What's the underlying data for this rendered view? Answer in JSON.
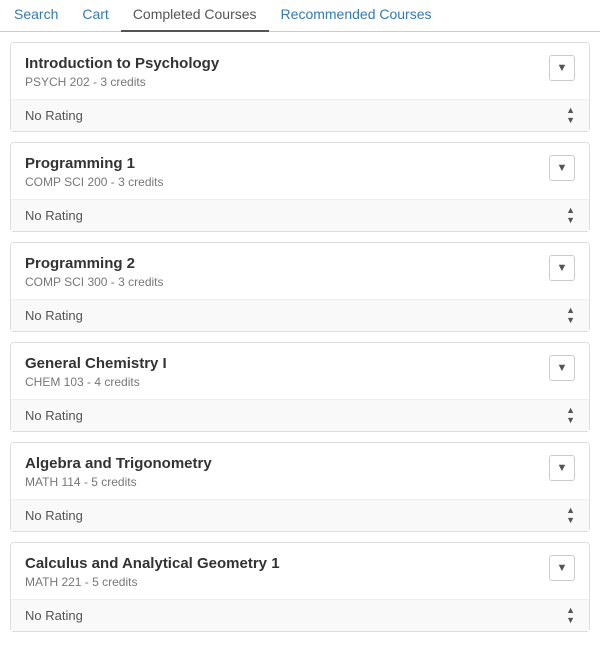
{
  "nav": {
    "tabs": [
      {
        "label": "Search",
        "active": false,
        "link": true
      },
      {
        "label": "Cart",
        "active": false,
        "link": false
      },
      {
        "label": "Completed Courses",
        "active": true,
        "link": false
      },
      {
        "label": "Recommended Courses",
        "active": false,
        "link": true
      }
    ]
  },
  "courses": [
    {
      "title": "Introduction to Psychology",
      "subtitle": "PSYCH 202 - 3 credits",
      "rating": "No Rating"
    },
    {
      "title": "Programming 1",
      "subtitle": "COMP SCI 200 - 3 credits",
      "rating": "No Rating"
    },
    {
      "title": "Programming 2",
      "subtitle": "COMP SCI 300 - 3 credits",
      "rating": "No Rating"
    },
    {
      "title": "General Chemistry I",
      "subtitle": "CHEM 103 - 4 credits",
      "rating": "No Rating"
    },
    {
      "title": "Algebra and Trigonometry",
      "subtitle": "MATH 114 - 5 credits",
      "rating": "No Rating"
    },
    {
      "title": "Calculus and Analytical Geometry 1",
      "subtitle": "MATH 221 - 5 credits",
      "rating": "No Rating"
    }
  ],
  "colors": {
    "link": "#337ab7",
    "active_tab": "#555"
  }
}
